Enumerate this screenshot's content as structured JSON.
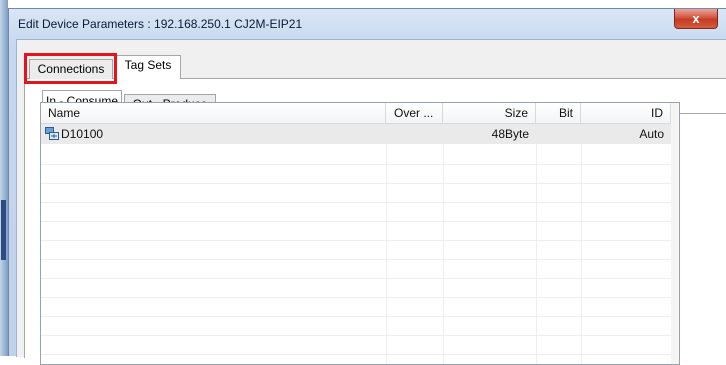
{
  "window": {
    "title": "Edit Device Parameters : 192.168.250.1 CJ2M-EIP21",
    "close_glyph": "x"
  },
  "tabs": [
    {
      "label": "Connections"
    },
    {
      "label": "Tag Sets"
    }
  ],
  "sub_tabs": [
    {
      "label": "In - Consume"
    },
    {
      "label": "Out - Produce"
    }
  ],
  "table": {
    "columns": [
      "Name",
      "Over ...",
      "Size",
      "Bit",
      "ID"
    ],
    "rows": [
      {
        "name": "D10100",
        "over": "",
        "size": "48Byte",
        "bit": "",
        "id": "Auto",
        "icon": "tag-icon"
      }
    ]
  },
  "colors": {
    "highlight": "#e3141b",
    "selected_row": "#eaeaea"
  }
}
